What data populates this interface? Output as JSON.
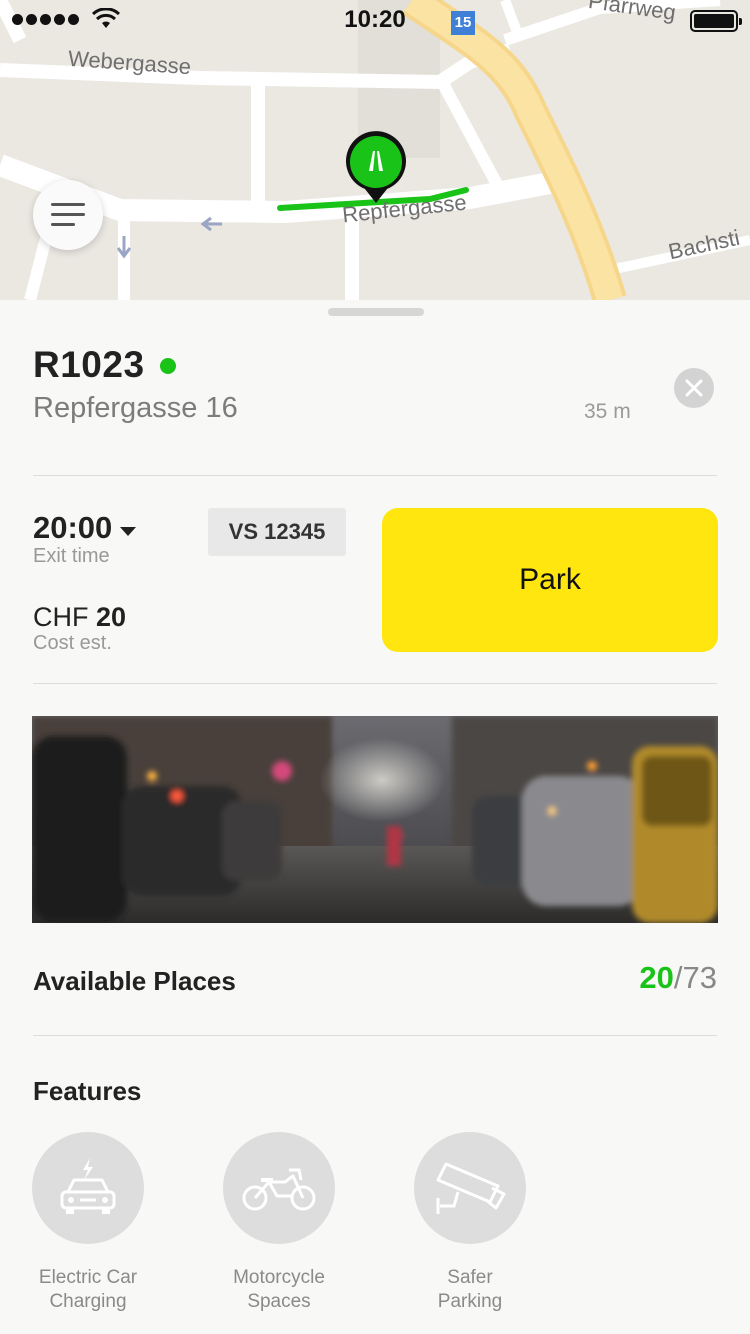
{
  "status_bar": {
    "time": "10:20",
    "signal_dots": 5,
    "route_badge": "15"
  },
  "map": {
    "streets": {
      "webergasse": "Webergasse",
      "repfergasse": "Repfergasse",
      "bachstr": "Bachsti",
      "pfarrweg": "Pfarrweg"
    },
    "highlight_color": "#19c318",
    "pin_color": "#19c318"
  },
  "spot": {
    "code": "R1023",
    "status_color": "#19c318",
    "address": "Repfergasse 16",
    "distance": "35 m"
  },
  "booking": {
    "exit_time": "20:00",
    "exit_label": "Exit time",
    "plate": "VS 12345",
    "cost_currency": "CHF",
    "cost_value": "20",
    "cost_label": "Cost est.",
    "park_label": "Park",
    "park_color": "#ffe60f"
  },
  "availability": {
    "label": "Available Places",
    "available": "20",
    "total": "/73"
  },
  "features": {
    "title": "Features",
    "items": [
      {
        "icon": "electric-car-icon",
        "line1": "Electric Car",
        "line2": "Charging"
      },
      {
        "icon": "motorcycle-icon",
        "line1": "Motorcycle",
        "line2": "Spaces"
      },
      {
        "icon": "security-camera-icon",
        "line1": "Safer",
        "line2": "Parking"
      }
    ]
  }
}
